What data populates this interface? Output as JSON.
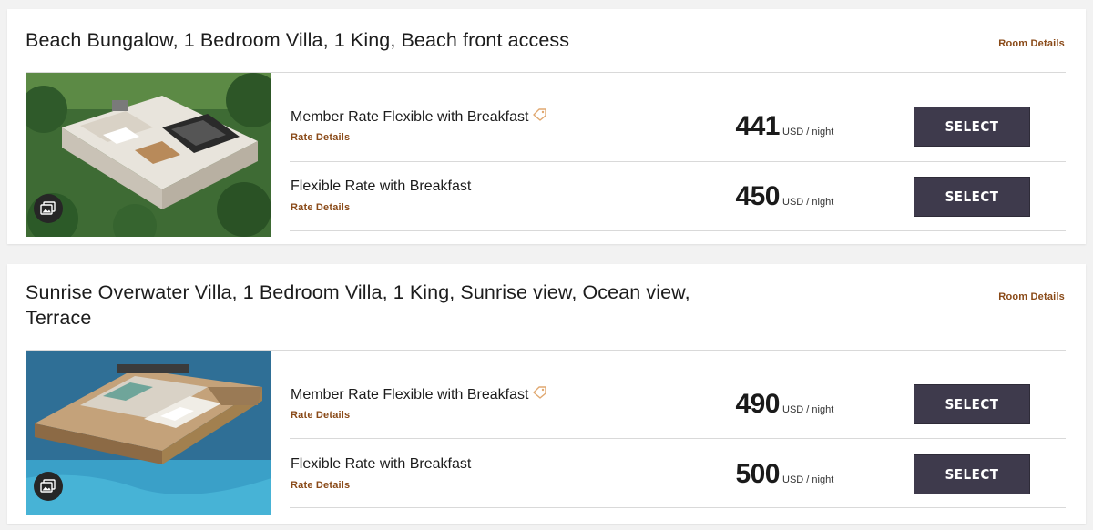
{
  "rooms": [
    {
      "title": "Beach Bungalow, 1 Bedroom Villa, 1 King, Beach front access",
      "room_details_label": "Room Details",
      "photo_icon": "gallery-icon",
      "rates": [
        {
          "name": "Member Rate Flexible with Breakfast",
          "has_tag_icon": true,
          "details_label": "Rate Details",
          "price": "441",
          "unit": "USD / night",
          "select_label": "SELECT"
        },
        {
          "name": "Flexible Rate with Breakfast",
          "has_tag_icon": false,
          "details_label": "Rate Details",
          "price": "450",
          "unit": "USD / night",
          "select_label": "SELECT"
        }
      ]
    },
    {
      "title": "Sunrise Overwater Villa, 1 Bedroom Villa, 1 King, Sunrise view, Ocean view, Terrace",
      "room_details_label": "Room Details",
      "photo_icon": "gallery-icon",
      "rates": [
        {
          "name": "Member Rate Flexible with Breakfast",
          "has_tag_icon": true,
          "details_label": "Rate Details",
          "price": "490",
          "unit": "USD / night",
          "select_label": "SELECT"
        },
        {
          "name": "Flexible Rate with Breakfast",
          "has_tag_icon": false,
          "details_label": "Rate Details",
          "price": "500",
          "unit": "USD / night",
          "select_label": "SELECT"
        }
      ]
    }
  ],
  "colors": {
    "accent_link": "#8a4a18",
    "select_button": "#3e3a4c",
    "tag_icon": "#e0a870"
  }
}
